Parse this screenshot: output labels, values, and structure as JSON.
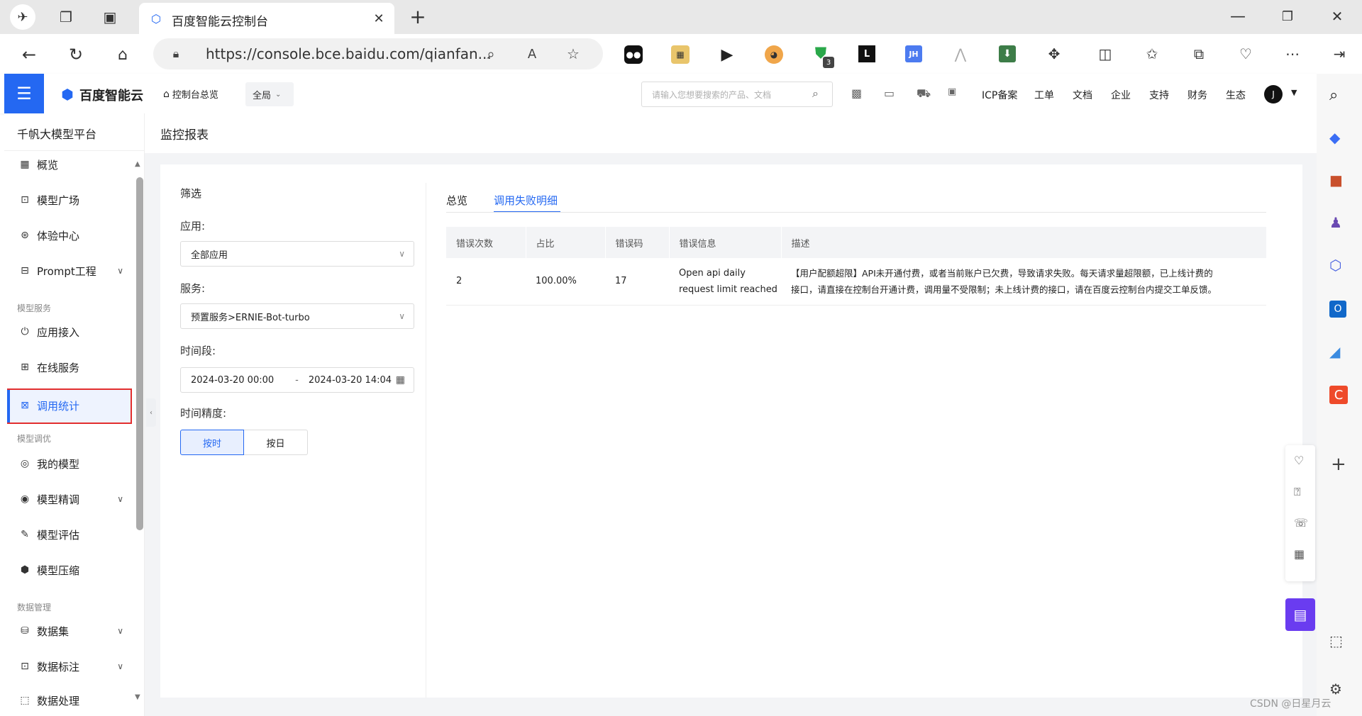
{
  "browser": {
    "tab_title": "百度智能云控制台",
    "url": "https://console.bce.baidu.com/qianfan...",
    "ext_badge": "3"
  },
  "header": {
    "logo_text": "百度智能云",
    "console_home": "控制台总览",
    "region": "全局",
    "search_placeholder": "请输入您想要搜索的产品、文档",
    "links": [
      "ICP备案",
      "工单",
      "文档",
      "企业",
      "支持",
      "财务",
      "生态"
    ],
    "avatar": "J"
  },
  "sidebar": {
    "title": "千帆大模型平台",
    "items": [
      {
        "label": "概览",
        "icon": "grid-icon"
      },
      {
        "label": "模型广场",
        "icon": "scan-icon"
      },
      {
        "label": "体验中心",
        "icon": "atom-icon"
      },
      {
        "label": "Prompt工程",
        "icon": "prompt-icon",
        "expand": true
      }
    ],
    "section1": "模型服务",
    "items2": [
      {
        "label": "应用接入",
        "icon": "power-icon"
      },
      {
        "label": "在线服务",
        "icon": "monitor-icon"
      },
      {
        "label": "调用统计",
        "icon": "chart-icon",
        "active": true
      }
    ],
    "section2": "模型调优",
    "items3": [
      {
        "label": "我的模型",
        "icon": "target-icon"
      },
      {
        "label": "模型精调",
        "icon": "tune-icon",
        "expand": true
      },
      {
        "label": "模型评估",
        "icon": "edit-icon"
      },
      {
        "label": "模型压缩",
        "icon": "compress-icon"
      }
    ],
    "section3": "数据管理",
    "items4": [
      {
        "label": "数据集",
        "icon": "database-icon",
        "expand": true
      },
      {
        "label": "数据标注",
        "icon": "tag-icon",
        "expand": true
      },
      {
        "label": "数据处理",
        "icon": "process-icon"
      }
    ]
  },
  "page": {
    "title": "监控报表",
    "filter": {
      "heading": "筛选",
      "app_label": "应用:",
      "app_value": "全部应用",
      "service_label": "服务:",
      "service_value": "预置服务>ERNIE-Bot-turbo",
      "period_label": "时间段:",
      "start": "2024-03-20 00:00",
      "dash": "-",
      "end": "2024-03-20 14:04",
      "precision_label": "时间精度:",
      "precision_options": [
        "按时",
        "按日"
      ]
    },
    "tabs": [
      "总览",
      "调用失败明细"
    ],
    "table": {
      "columns": [
        "错误次数",
        "占比",
        "错误码",
        "错误信息",
        "描述"
      ],
      "rows": [
        {
          "count": "2",
          "ratio": "100.00%",
          "code": "17",
          "message_line1": "Open api daily",
          "message_line2": "request limit reached",
          "desc_line1": "【用户配额超限】API未开通付费，或者当前账户已欠费，导致请求失败。每天请求量超限额，已上线计费的",
          "desc_line2": "接口，请直接在控制台开通计费，调用量不受限制；未上线计费的接口，请在百度云控制台内提交工单反馈。"
        }
      ]
    }
  },
  "watermark": "CSDN @日星月云"
}
